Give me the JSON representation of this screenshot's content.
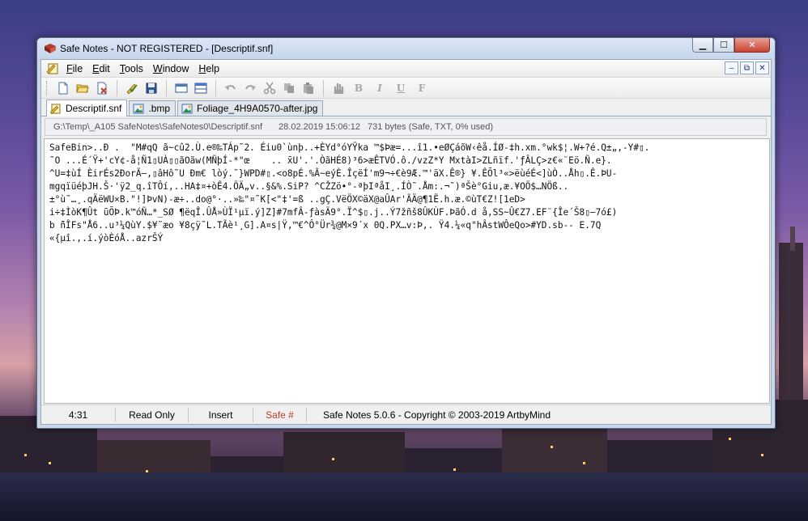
{
  "window": {
    "title": "Safe Notes - NOT REGISTERED - [Descriptif.snf]",
    "caption": {
      "minimize": "▁",
      "maximize": "☐",
      "close": "✕"
    }
  },
  "menu": {
    "items": [
      {
        "key": "F",
        "rest": "ile"
      },
      {
        "key": "E",
        "rest": "dit"
      },
      {
        "key": "T",
        "rest": "ools"
      },
      {
        "key": "W",
        "rest": "indow"
      },
      {
        "key": "H",
        "rest": "elp"
      }
    ],
    "mdi": {
      "minimize": "–",
      "restore": "⧉",
      "close": "✕"
    }
  },
  "toolbar": {
    "format_bold": "B",
    "format_italic": "I",
    "format_underline": "U",
    "format_font": "F"
  },
  "tabs": [
    {
      "label": "Descriptif.snf",
      "icon": "safe-notes-doc-icon",
      "active": true
    },
    {
      "label": ".bmp",
      "icon": "image-file-icon",
      "active": false
    },
    {
      "label": "Foliage_4H9A0570-after.jpg",
      "icon": "image-file-icon",
      "active": false
    }
  ],
  "path": {
    "file": "G:\\Temp\\_A105 SafeNotes\\SafeNotes0\\Descriptif.snf",
    "datetime": "28.02.2019 15:06:12",
    "info": "731 bytes (Safe, TXT, 0% used)"
  },
  "editor": {
    "lines": [
      "SafeBin>..Đ .  \"M#qQ ã~cû2.Ù.e®‰TÁp˜2. Éiu0`ùnþ..+ÈYd°óYŸka ™$Þæ=...î1.•eØÇáõW‹êå.ÍØ-‡h.xm.°wk$¦.W+?é.Q±„,-Y#▯.",
      "˜O ...É´Ÿ+'cY¢-å¦Ñ1▯UÀ▯▯ãOãw(MÑþÍ-*\"œ    .. ̄xU'.'.ÒãHÉ8)³6>æÊTVÓ.ô./vzZ*Y MxtàI>ZLñïf.'ƒÂLÇ>z€«¨Eö.Ñ.e}.",
      "^U=‡ùÍ ÈirÉs2ÐorÃ—,▯âHô˜U Ðm€ lòý.˜}WPD#▯.<o8pÉ.%Ã~eýÈ.ÎçëÍ'm9¬÷€è9Æ.™'äX.Ê®} ¥.ÊÕl³«>ëùéÉ<]ùÒ..Åh▯.Ê.ÞU-",
      "mgqïüéþJH.Š·'ÿ2_q.îTÔí,..HA‡¤+òÊ4.ÖÄ„v..§&%.SiP? ^CŽZö•°-ªþIªåI¸.ÍÒ˜.Åm:.¬˜)ªŠè°Giu,æ.¥OÖ$…NÖß..",
      "±°ù˜…¸.qÄëWU×B.\"!]ÞvN)-æ÷..do@°·..»‰\"¤˜K[<\"‡'=ß ..gÇ.VëÖX©äX@aÛAr'ÃÄ@¶1Ë.h.æ.©ùT€Z![1eD>",
      "i÷‡ÌòK¶Ût ̄uÕÞ.k™óÑ…*_SØ ¶ëqÎ.ÛÅ»ÙÏ¹µï.ý]Z]#7mfÂ-ƒàsÄ9°.Ï^$▯.j..Ý7žñš8ÛKÙF.ÞãÓ.d å,SS~Û€Z7.EF¨{Îe´Š8▯—7ó£)",
      "b ̄ñÎFs\"Å6..u³¼QùY.$¥˜æo ¥8çÿ˜L.TÃè¹¸G].A¤s|Ÿ,™€^Ô°Ür¾@M×9´x 0Q.PX…v:Þ,. Ÿ4.¼«q\"hÂstWÔeQo>#YD.sb-- E.7Q",
      "«{µî.,.í.ýòÈóÅ..azrŠÝ"
    ]
  },
  "status": {
    "position": "4:31",
    "mode": "Read Only",
    "insert": "Insert",
    "safe": "Safe #",
    "about": "Safe Notes 5.0.6  -  Copyright © 2003-2019 ArtbyMind"
  },
  "colors": {
    "safe_status": "#c0392b"
  }
}
